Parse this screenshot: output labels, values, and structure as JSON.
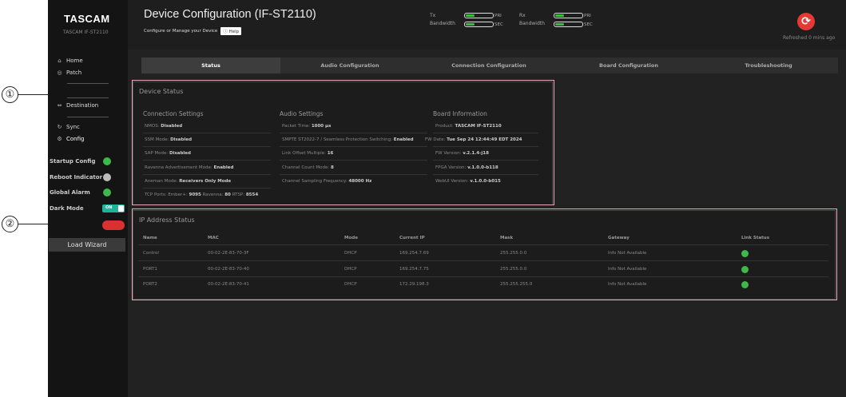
{
  "brand": "TASCAM",
  "model": "TASCAM IF-ST2110",
  "sidebar": {
    "items": [
      {
        "label": "Home",
        "icon": "home-icon",
        "glyph": "⌂"
      },
      {
        "label": "Patch",
        "icon": "patch-icon",
        "glyph": "◎"
      },
      {
        "label": "Destination",
        "icon": "destination-icon",
        "glyph": "⇔"
      },
      {
        "label": "Sync",
        "icon": "sync-icon",
        "glyph": "↻"
      },
      {
        "label": "Config",
        "icon": "config-icon",
        "glyph": "⚙"
      }
    ],
    "toggles": [
      {
        "label": "Startup Config",
        "state": "green"
      },
      {
        "label": "Reboot Indicator",
        "state": "grey"
      },
      {
        "label": "Global Alarm",
        "state": "green"
      },
      {
        "label": "Dark Mode",
        "state": "on"
      }
    ],
    "dark_mode_switch": "ON",
    "load_wizard": "Load Wizard"
  },
  "header": {
    "title": "Device Configuration (IF-ST2110)",
    "subtitle": "Configure or Manage your Device",
    "help": "Help",
    "tx": {
      "label": "Tx",
      "bandwidth": "Bandwidth",
      "pri": "PRI",
      "sec": "SEC"
    },
    "rx": {
      "label": "Rx",
      "bandwidth": "Bandwidth",
      "pri": "PRI",
      "sec": "SEC"
    },
    "refreshed": "Refreshed 0 mins ago"
  },
  "tabs": [
    "Status",
    "Audio Configuration",
    "Connection Configuration",
    "Board Configuration",
    "Troubleshooting"
  ],
  "device_status": {
    "title": "Device Status",
    "connection": {
      "heading": "Connection Settings",
      "rows": [
        {
          "k": "NMOS:",
          "v": "Disabled"
        },
        {
          "k": "SSM Mode:",
          "v": "Disabled"
        },
        {
          "k": "SAP Mode:",
          "v": "Disabled"
        },
        {
          "k": "Ravenna Advertisement Mode:",
          "v": "Enabled"
        },
        {
          "k": "Aneman Mode:",
          "v": "Receivers Only Mode"
        }
      ],
      "tcp": {
        "label": "TCP Ports:",
        "ember_k": "Ember+:",
        "ember_v": "9095",
        "ravenna_k": "Ravenna:",
        "ravenna_v": "80",
        "rtsp_k": "RTSP:",
        "rtsp_v": "8554"
      }
    },
    "audio": {
      "heading": "Audio Settings",
      "rows": [
        {
          "k": "Packet Time:",
          "v": "1000 µs"
        },
        {
          "k": "SMPTE ST2022-7 / Seamless Protection Switching:",
          "v": "Enabled"
        },
        {
          "k": "Link Offset Multiple:",
          "v": "16"
        },
        {
          "k": "Channel Count Mode:",
          "v": "8"
        },
        {
          "k": "Channel Sampling Frequency:",
          "v": "48000 Hz"
        }
      ]
    },
    "board": {
      "heading": "Board Information",
      "rows": [
        {
          "k": "Product:",
          "v": "TASCAM IF-ST2110"
        },
        {
          "k": "FW Date:",
          "v": "Tue Sep 24 12:44:49 EDT 2024"
        },
        {
          "k": "FW Version:",
          "v": "v.2.1.4-j18"
        },
        {
          "k": "FPGA Version:",
          "v": "v.1.0.0-b118"
        },
        {
          "k": "WebUI Version:",
          "v": "v.1.0.0-b015"
        }
      ]
    }
  },
  "ip_status": {
    "title": "IP Address Status",
    "headers": [
      "Name",
      "MAC",
      "Mode",
      "Current IP",
      "Mask",
      "Gateway",
      "Link Status"
    ],
    "rows": [
      {
        "name": "Control",
        "mac": "00-02-2E-83-70-3F",
        "mode": "DHCP",
        "ip": "169.254.7.69",
        "mask": "255.255.0.0",
        "gateway": "Info Not Available"
      },
      {
        "name": "PORT1",
        "mac": "00-02-2E-83-70-40",
        "mode": "DHCP",
        "ip": "169.254.7.75",
        "mask": "255.255.0.0",
        "gateway": "Info Not Available"
      },
      {
        "name": "PORT2",
        "mac": "00-02-2E-83-70-41",
        "mode": "DHCP",
        "ip": "172.29.198.3",
        "mask": "255.255.255.0",
        "gateway": "Info Not Available"
      }
    ]
  },
  "callouts": [
    "①",
    "②"
  ],
  "colors": {
    "accent_green": "#3db84a",
    "refresh_red": "#e53935",
    "toggle_teal": "#20b39a",
    "annotation_pink": "#e8a8b8"
  }
}
